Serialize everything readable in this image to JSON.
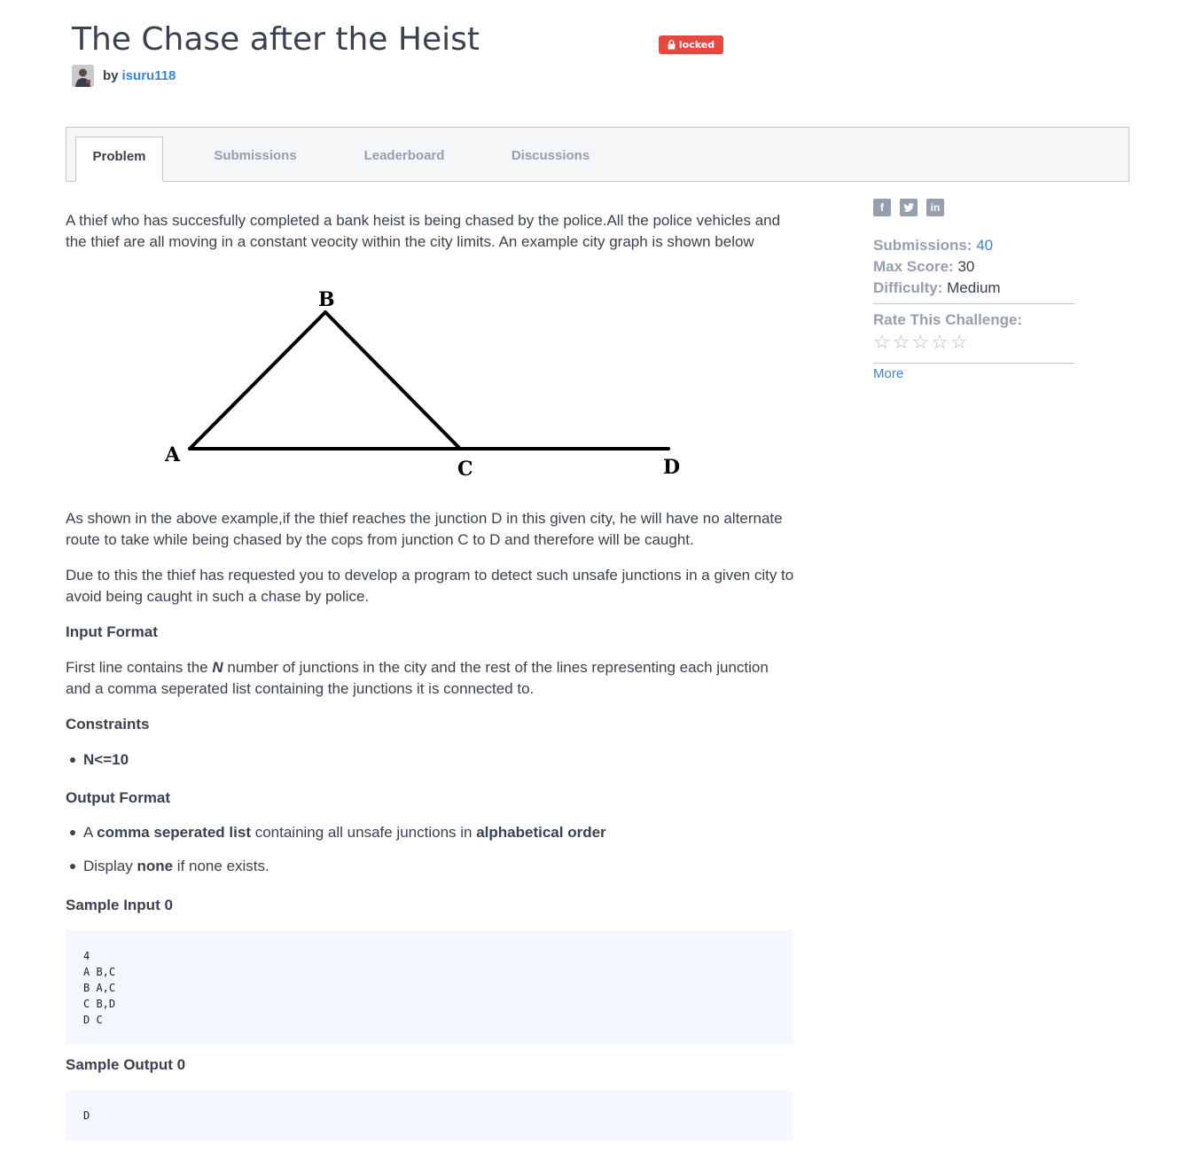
{
  "challenge": {
    "title": "The Chase after the Heist",
    "status_badge": "locked",
    "author_prefix": "by",
    "author": "isuru118"
  },
  "tabs": [
    {
      "label": "Problem",
      "active": true
    },
    {
      "label": "Submissions",
      "active": false
    },
    {
      "label": "Leaderboard",
      "active": false
    },
    {
      "label": "Discussions",
      "active": false
    }
  ],
  "problem": {
    "intro": "A thief who has succesfully completed a bank heist is being chased by the police.All the police vehicles and the thief are all moving in a constant veocity within the city limits. An example city graph is shown below",
    "graph": {
      "nodes": [
        "A",
        "B",
        "C",
        "D"
      ],
      "edges": [
        [
          "A",
          "B"
        ],
        [
          "A",
          "C"
        ],
        [
          "B",
          "C"
        ],
        [
          "C",
          "D"
        ]
      ]
    },
    "para2": "As shown in the above example,if the thief reaches the junction D in this given city, he will have no alternate route to take while being chased by the cops from junction C to D and therefore will be caught.",
    "para3": "Due to this the thief has requested you to develop a program to detect such unsafe junctions in a given city to avoid being caught in such a chase by police.",
    "input_format_heading": "Input Format",
    "input_format_pre": "First line contains the ",
    "input_format_var": "N",
    "input_format_post": " number of junctions in the city and the rest of the lines representing each junction and a comma seperated list containing the junctions it is connected to.",
    "constraints_heading": "Constraints",
    "constraint_1": "N<=10",
    "output_format_heading": "Output Format",
    "output_bullet_1": {
      "pre": "A ",
      "b1": "comma seperated list",
      "mid": " containing all unsafe junctions in ",
      "b2": "alphabetical order"
    },
    "output_bullet_2": {
      "pre": "Display ",
      "b1": "none",
      "post": " if none exists."
    },
    "sample_input_heading": "Sample Input 0",
    "sample_input": "4\nA B,C\nB A,C\nC B,D\nD C",
    "sample_output_heading": "Sample Output 0",
    "sample_output": "D"
  },
  "sidebar": {
    "social_icons": [
      "facebook-icon",
      "twitter-icon",
      "linkedin-icon"
    ],
    "submissions_label": "Submissions:",
    "submissions_value": "40",
    "max_score_label": "Max Score:",
    "max_score_value": "30",
    "difficulty_label": "Difficulty:",
    "difficulty_value": "Medium",
    "rate_label": "Rate This Challenge:",
    "rating": 0,
    "rating_max": 5,
    "more_label": "More"
  }
}
